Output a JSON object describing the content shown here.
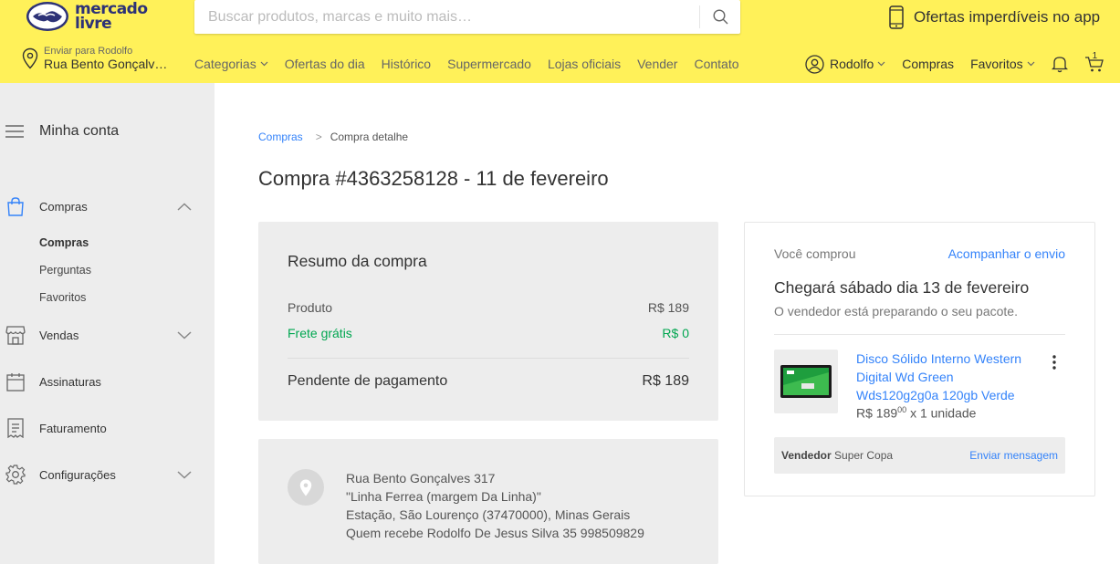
{
  "header": {
    "logo_line1": "mercado",
    "logo_line2": "livre",
    "search_placeholder": "Buscar produtos, marcas e muito mais…",
    "promo": "Ofertas imperdíveis no app",
    "address": {
      "label": "Enviar para Rodolfo",
      "street": "Rua Bento Gonçalv…"
    },
    "nav": [
      "Categorias",
      "Ofertas do dia",
      "Histórico",
      "Supermercado",
      "Lojas oficiais",
      "Vender",
      "Contato"
    ],
    "user": {
      "name": "Rodolfo",
      "purchases": "Compras",
      "favorites": "Favoritos",
      "cart_count": "1"
    },
    "colors": {
      "brand_yellow": "#fff159",
      "link_blue": "#3483fa",
      "success_green": "#00a650"
    }
  },
  "sidebar": {
    "title": "Minha conta",
    "sections": [
      {
        "label": "Compras",
        "icon": "bag-icon",
        "expanded": true
      },
      {
        "label": "Vendas",
        "icon": "store-icon",
        "expanded": false
      },
      {
        "label": "Assinaturas",
        "icon": "calendar-icon"
      },
      {
        "label": "Faturamento",
        "icon": "receipt-icon"
      },
      {
        "label": "Configurações",
        "icon": "gear-icon",
        "expanded": false
      }
    ],
    "compras_sub": [
      "Compras",
      "Perguntas",
      "Favoritos"
    ]
  },
  "main": {
    "breadcrumb": {
      "link": "Compras",
      "separator": ">",
      "current": "Compra detalhe"
    },
    "title": "Compra #4363258128 - 11 de fevereiro",
    "resumo": {
      "title": "Resumo da compra",
      "product_label": "Produto",
      "product_value": "R$ 189",
      "shipping_label": "Frete grátis",
      "shipping_value": "R$ 0",
      "total_label": "Pendente de pagamento",
      "total_value": "R$ 189"
    },
    "address": {
      "line1": "Rua Bento Gonçalves 317",
      "line2": "\"Linha Ferrea (margem Da Linha)\"",
      "line3": "Estação, São Lourenço (37470000), Minas Gerais",
      "line4": "Quem recebe Rodolfo De Jesus Silva 35 998509829"
    },
    "pedido": {
      "label": "Você comprou",
      "track": "Acompanhar o envio",
      "arrival": "Chegará sábado dia 13 de fevereiro",
      "status": "O vendedor está preparando o seu pacote.",
      "product": "Disco Sólido Interno Western Digital Wd Green Wds120g2g0a 120gb Verde",
      "price_main": "R$ 189",
      "price_cents": "00",
      "quantity": "x 1 unidade",
      "vendor_label": "Vendedor",
      "vendor_name": "Super Copa",
      "vendor_action": "Enviar mensagem"
    }
  }
}
